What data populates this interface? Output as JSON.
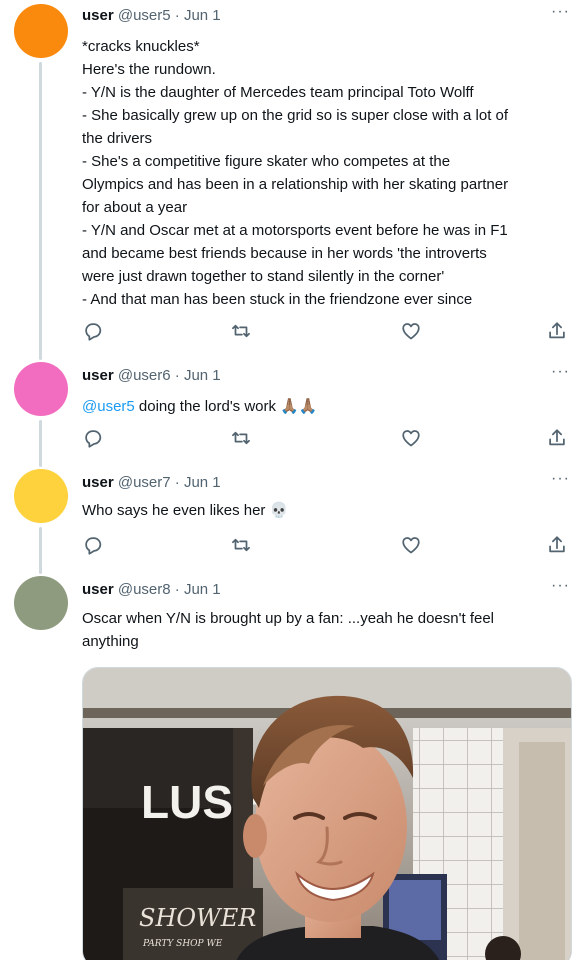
{
  "colors": {
    "accent": "#1d9bf0",
    "avatar_user5": "#f98a0d",
    "avatar_user6": "#f26dc0",
    "avatar_user7": "#fed23d",
    "avatar_user8": "#8e9b7f"
  },
  "tweets": [
    {
      "name": "user",
      "handle": "@user5",
      "date": "· Jun 1",
      "more": "···",
      "lines": [
        "*cracks knuckles*",
        "Here's the rundown.",
        "- Y/N is the daughter of Mercedes team principal Toto Wolff",
        "- She basically grew up on the grid so is super close with a lot of",
        "the drivers",
        "- She's a competitive figure skater who competes at the",
        "Olympics and has been in a relationship with her skating partner",
        "for about a year",
        "- Y/N and Oscar met at a motorsports event before he was in F1",
        "and became best friends because in her words 'the introverts",
        "were just drawn together to stand silently in the corner'",
        "- And that man has been stuck in the friendzone ever since"
      ]
    },
    {
      "name": "user",
      "handle": "@user6",
      "date": "· Jun 1",
      "more": "···",
      "mention": "@user5",
      "text": " doing the lord's work 🙏🏽🙏🏽"
    },
    {
      "name": "user",
      "handle": "@user7",
      "date": "· Jun 1",
      "more": "···",
      "text": "Who says he even likes her 💀"
    },
    {
      "name": "user",
      "handle": "@user8",
      "date": "· Jun 1",
      "more": "···",
      "lines": [
        "Oscar when Y/N is brought up by a fan: ...yeah he doesn't feel",
        "anything"
      ],
      "media": {
        "store_sign": "LUSH",
        "shop_sign": "SHOWER",
        "shop_sub": "PARTY SHOP WE"
      }
    }
  ],
  "action_icons": [
    "reply-icon",
    "retweet-icon",
    "like-icon",
    "share-icon"
  ]
}
